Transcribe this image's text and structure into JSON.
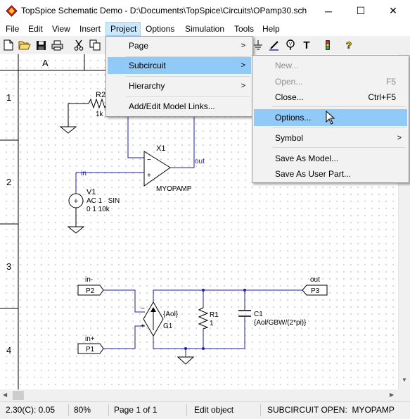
{
  "window": {
    "title": "TopSpice Schematic Demo - D:\\Documents\\TopSpice\\Circuits\\OPamp30.sch",
    "icon": "topspice-app-icon",
    "minimize": "─",
    "maximize": "☐",
    "close": "✕"
  },
  "menubar": {
    "items": [
      "File",
      "Edit",
      "View",
      "Insert",
      "Project",
      "Options",
      "Simulation",
      "Tools",
      "Help"
    ],
    "active": "Project"
  },
  "toolbar": {
    "icons": [
      "new-document-icon",
      "open-folder-icon",
      "save-icon",
      "print-icon",
      "cut-icon",
      "copy-icon",
      "ground-tool-icon",
      "pen-icon",
      "probe-icon",
      "text-tool-icon",
      "traffic-light-icon",
      "help-icon"
    ]
  },
  "project_menu": {
    "items": [
      {
        "label": "Page",
        "submenu": true
      },
      {
        "label": "Subcircuit",
        "submenu": true,
        "highlighted": true
      },
      {
        "label": "Hierarchy",
        "submenu": true
      },
      {
        "label": "Add/Edit Model Links...",
        "submenu": false
      }
    ]
  },
  "subcircuit_menu": {
    "items": [
      {
        "label": "New...",
        "disabled": true
      },
      {
        "label": "Open...",
        "shortcut": "F5",
        "disabled": true
      },
      {
        "label": "Close...",
        "shortcut": "Ctrl+F5"
      },
      {
        "label": "Options...",
        "highlighted": true
      },
      {
        "label": "Symbol",
        "submenu": true
      },
      {
        "label": "Save As Model..."
      },
      {
        "label": "Save As User Part..."
      }
    ]
  },
  "schematic": {
    "column_label": "A",
    "row_labels": [
      "1",
      "2",
      "3",
      "4"
    ],
    "r2": {
      "name": "R2",
      "value": "1k"
    },
    "x1": {
      "name": "X1",
      "model": "MYOPAMP"
    },
    "v1": {
      "name": "V1",
      "line1": "AC 1   SIN",
      "line2": "0 1 10k"
    },
    "nets": {
      "in": "in",
      "out": "out",
      "out_port_label": "out",
      "in_minus": "in-",
      "in_plus": "in+"
    },
    "ports": {
      "p1": "P1",
      "p2": "P2",
      "p3": "P3"
    },
    "g1": {
      "name": "G1",
      "value": "{Aol}"
    },
    "r1": {
      "name": "R1",
      "value": "1"
    },
    "c1": {
      "name": "C1",
      "value": "{Aol/GBW/(2*pi)}"
    },
    "wire_color": "#1f1fa0",
    "label_color": "#1515c8"
  },
  "statusbar": {
    "coords": "2.30(C): 0.05",
    "zoom": "80%",
    "page": "Page 1 of 1",
    "mode": "Edit object",
    "subcircuit": "SUBCIRCUIT OPEN:  MYOPAMP"
  }
}
